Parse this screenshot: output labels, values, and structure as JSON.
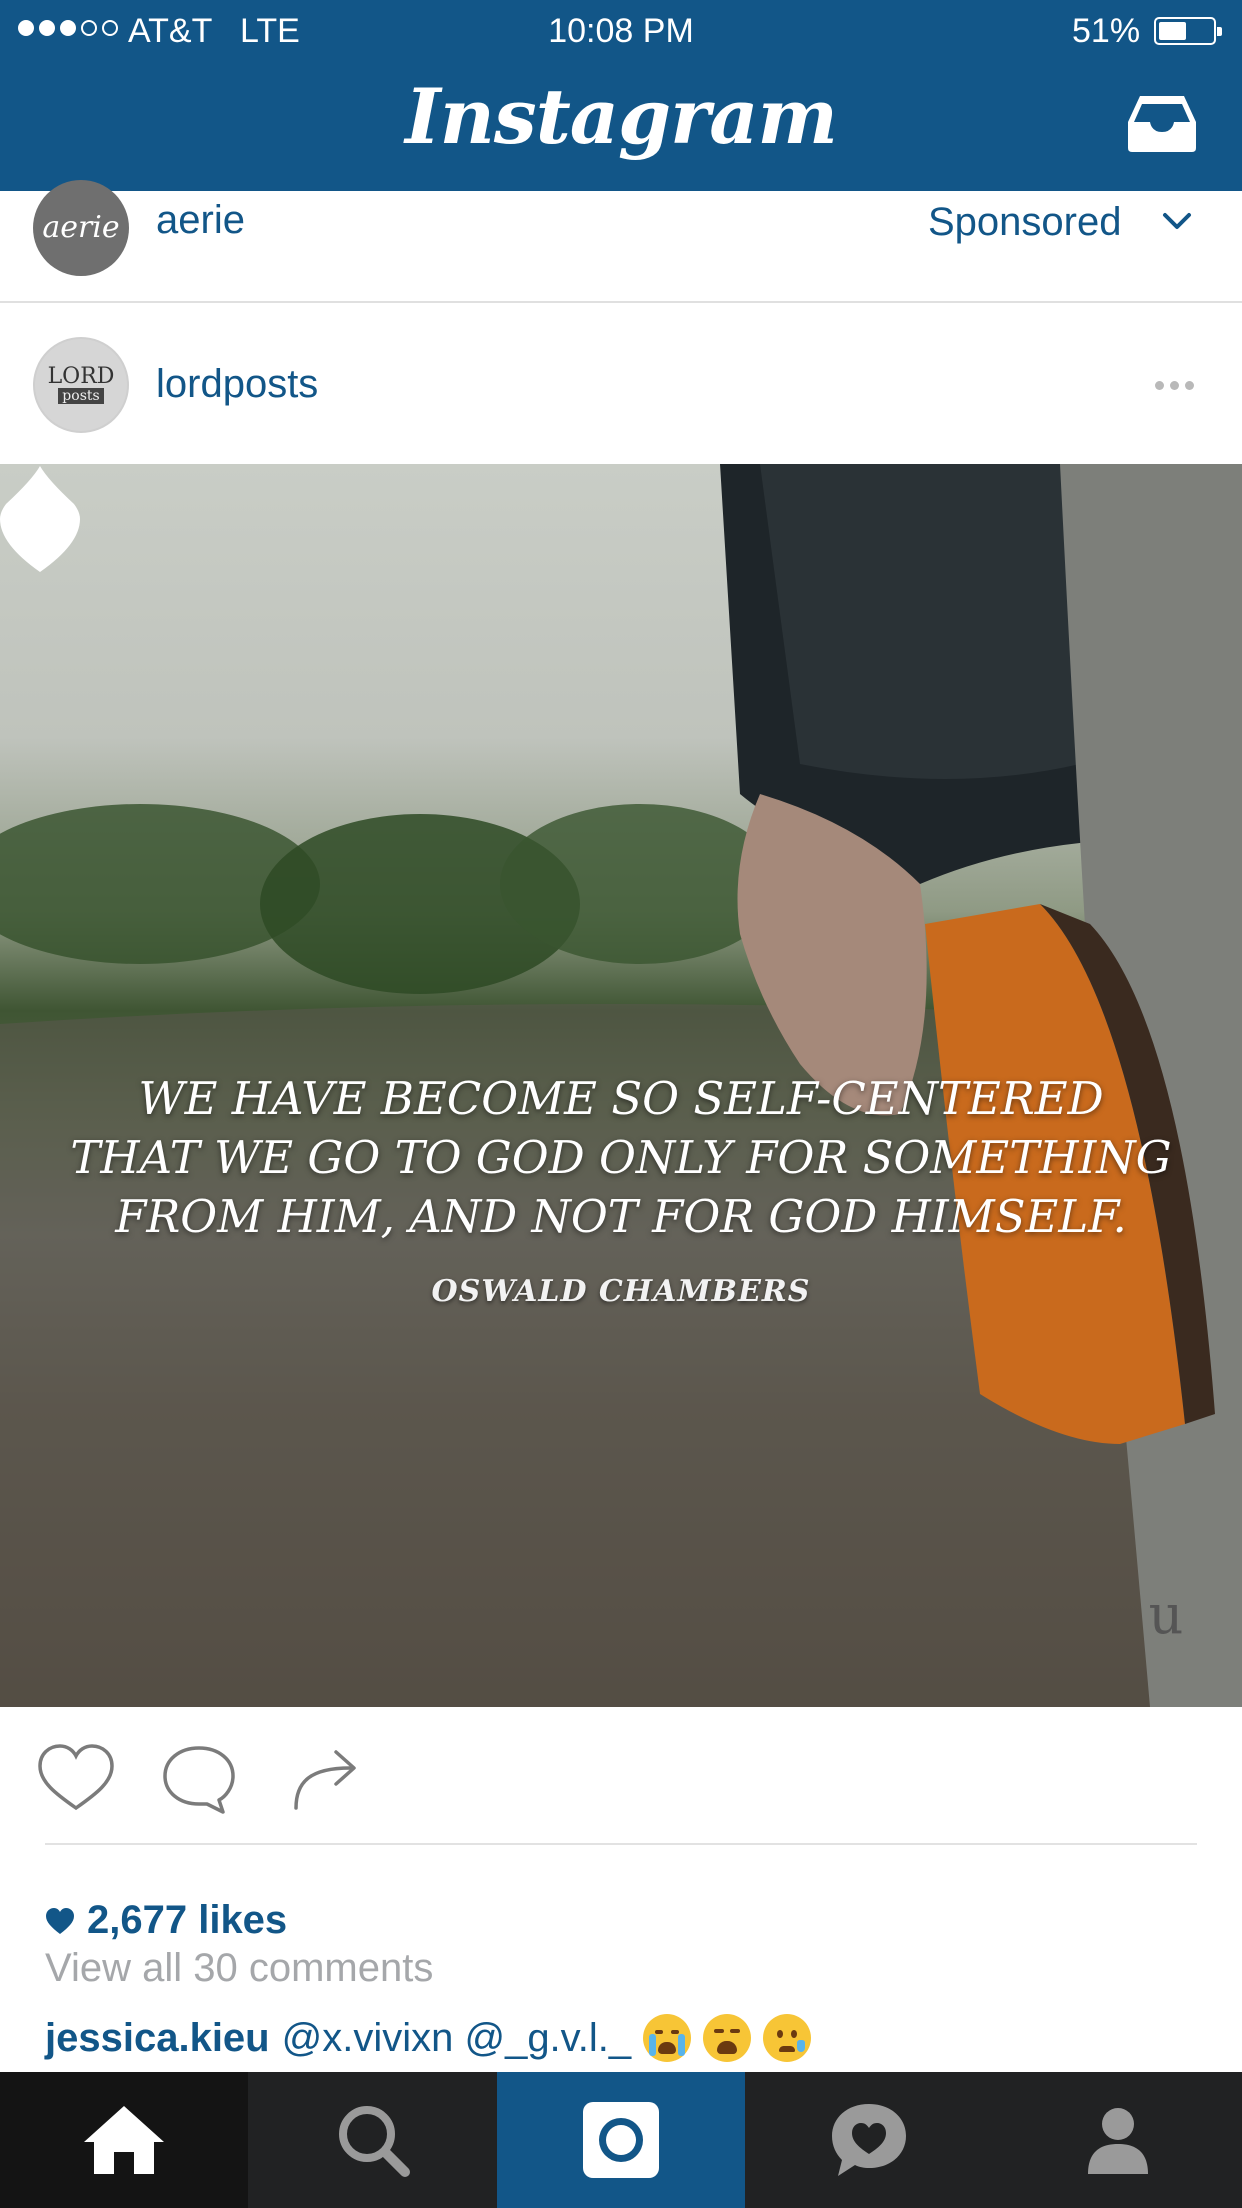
{
  "status_bar": {
    "signal_bars_filled": 3,
    "signal_bars_total": 5,
    "carrier": "AT&T",
    "network": "LTE",
    "time": "10:08 PM",
    "battery_percent": "51%",
    "battery_level": 0.51
  },
  "nav": {
    "title": "Instagram",
    "inbox_icon": "inbox-tray-icon"
  },
  "sponsored_post": {
    "avatar_text": "aerie",
    "username": "aerie",
    "label": "Sponsored"
  },
  "post": {
    "avatar_text_1": "LORD",
    "avatar_text_2": "posts",
    "username": "lordposts",
    "quote_lines": [
      "WE HAVE BECOME SO SELF-CENTERED",
      "THAT WE GO TO GOD ONLY FOR SOMETHING",
      "FROM HIM, AND NOT FOR GOD HIMSELF."
    ],
    "quote_author": "OSWALD CHAMBERS",
    "watermark": "u",
    "likes": "2,677 likes",
    "view_all": "View all 30 comments",
    "comment": {
      "author": "jessica.kieu",
      "mentions": "@x.vivixn @_g.v.l._",
      "emojis": [
        "loudly-crying-face",
        "tired-face",
        "crying-face"
      ]
    }
  },
  "tabbar": {
    "tabs": [
      {
        "name": "home",
        "icon": "home-icon",
        "active": true
      },
      {
        "name": "explore",
        "icon": "search-icon",
        "active": false
      },
      {
        "name": "camera",
        "icon": "camera-icon",
        "active": false
      },
      {
        "name": "activity",
        "icon": "heart-bubble-icon",
        "active": false
      },
      {
        "name": "profile",
        "icon": "person-icon",
        "active": false
      }
    ]
  },
  "colors": {
    "brand_blue": "#125688",
    "tabbar_bg": "#212223",
    "muted_text": "#a5a7aa"
  }
}
